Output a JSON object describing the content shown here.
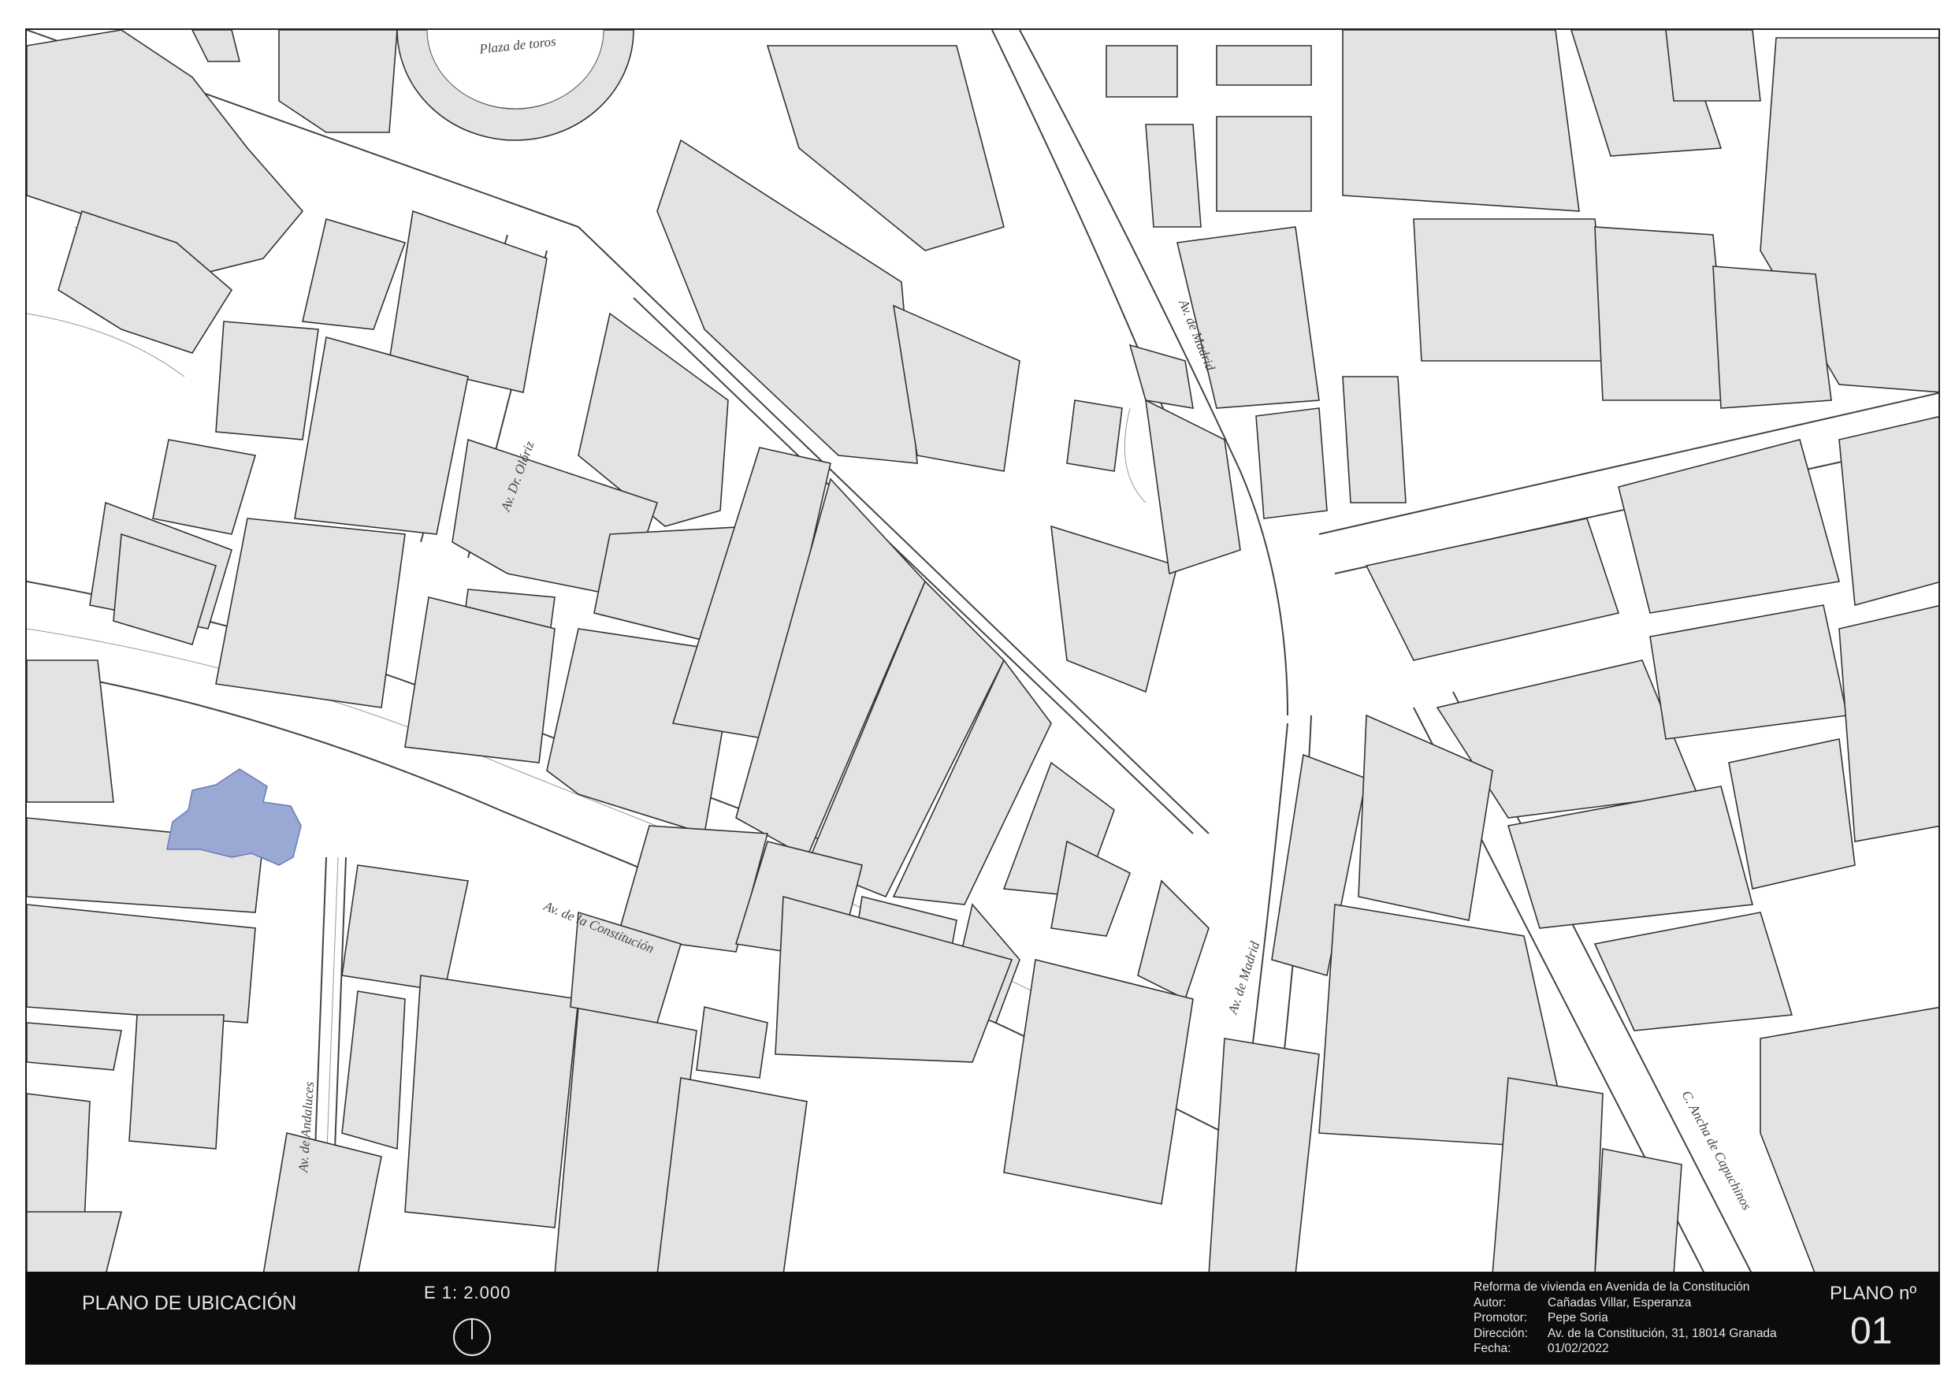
{
  "map": {
    "streets": [
      {
        "label": "Plaza de toros"
      },
      {
        "label": "Av. Dr. Olóriz"
      },
      {
        "label": "Av. de Madrid"
      },
      {
        "label": "Av. de Madrid"
      },
      {
        "label": "Av. de la Constitución"
      },
      {
        "label": "Av. de Andaluces"
      },
      {
        "label": "C. Ancha de Capuchinos"
      }
    ],
    "colors": {
      "building_fill": "#e3e3e3",
      "building_stroke": "#333333",
      "highlight_fill": "#9aa8d4",
      "background": "#ffffff"
    }
  },
  "title_block": {
    "title": "PLANO DE UBICACIÓN",
    "scale": "E  1: 2.000",
    "north_symbol": "north-arrow-icon",
    "project": "Reforma de vivienda en Avenida de la Constitución",
    "fields": [
      {
        "key": "Autor:",
        "value": "Cañadas Villar, Esperanza"
      },
      {
        "key": "Promotor:",
        "value": "Pepe Soria"
      },
      {
        "key": "Dirección:",
        "value": "Av. de la Constitución, 31, 18014 Granada"
      },
      {
        "key": "Fecha:",
        "value": "01/02/2022"
      }
    ],
    "plan_number_label": "PLANO nº",
    "plan_number": "01"
  }
}
